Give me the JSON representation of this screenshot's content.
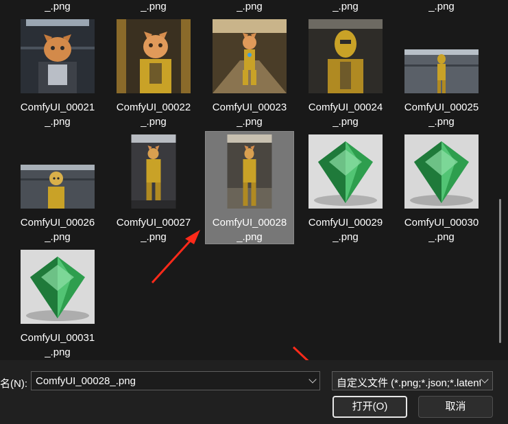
{
  "top_row_captions": [
    "_.png",
    "_.png",
    "_.png",
    "_.png",
    "_.png"
  ],
  "files": [
    {
      "line1": "ComfyUI_00021",
      "line2": "_.png",
      "thumb": "cat-robot-icon",
      "selected": false
    },
    {
      "line1": "ComfyUI_00022",
      "line2": "_.png",
      "thumb": "cat-robot-icon",
      "selected": false
    },
    {
      "line1": "ComfyUI_00023",
      "line2": "_.png",
      "thumb": "cat-robot-icon",
      "selected": false
    },
    {
      "line1": "ComfyUI_00024",
      "line2": "_.png",
      "thumb": "gold-robot-icon",
      "selected": false
    },
    {
      "line1": "ComfyUI_00025",
      "line2": "_.png",
      "thumb": "gold-robot-icon",
      "selected": false
    },
    {
      "line1": "ComfyUI_00026",
      "line2": "_.png",
      "thumb": "gold-robot-icon",
      "selected": false
    },
    {
      "line1": "ComfyUI_00027",
      "line2": "_.png",
      "thumb": "cat-robot-icon",
      "selected": false
    },
    {
      "line1": "ComfyUI_00028",
      "line2": "_.png",
      "thumb": "cat-robot-icon",
      "selected": true
    },
    {
      "line1": "ComfyUI_00029",
      "line2": "_.png",
      "thumb": "emerald-gem-icon",
      "selected": false
    },
    {
      "line1": "ComfyUI_00030",
      "line2": "_.png",
      "thumb": "emerald-gem-icon",
      "selected": false
    },
    {
      "line1": "ComfyUI_00031",
      "line2": "_.png",
      "thumb": "emerald-gem-icon",
      "selected": false
    }
  ],
  "filename": {
    "label": "名(N):",
    "value": "ComfyUI_00028_.png"
  },
  "filter": {
    "value": "自定义文件 (*.png;*.json;*.latent;*.safetensors;*.flac)"
  },
  "buttons": {
    "open": "打开(O)",
    "cancel": "取消"
  },
  "colors": {
    "background": "#191919",
    "selection": "#777777",
    "arrow": "#ff2a1a",
    "gold": "#c9a227",
    "emerald": "#2e9e4e"
  }
}
